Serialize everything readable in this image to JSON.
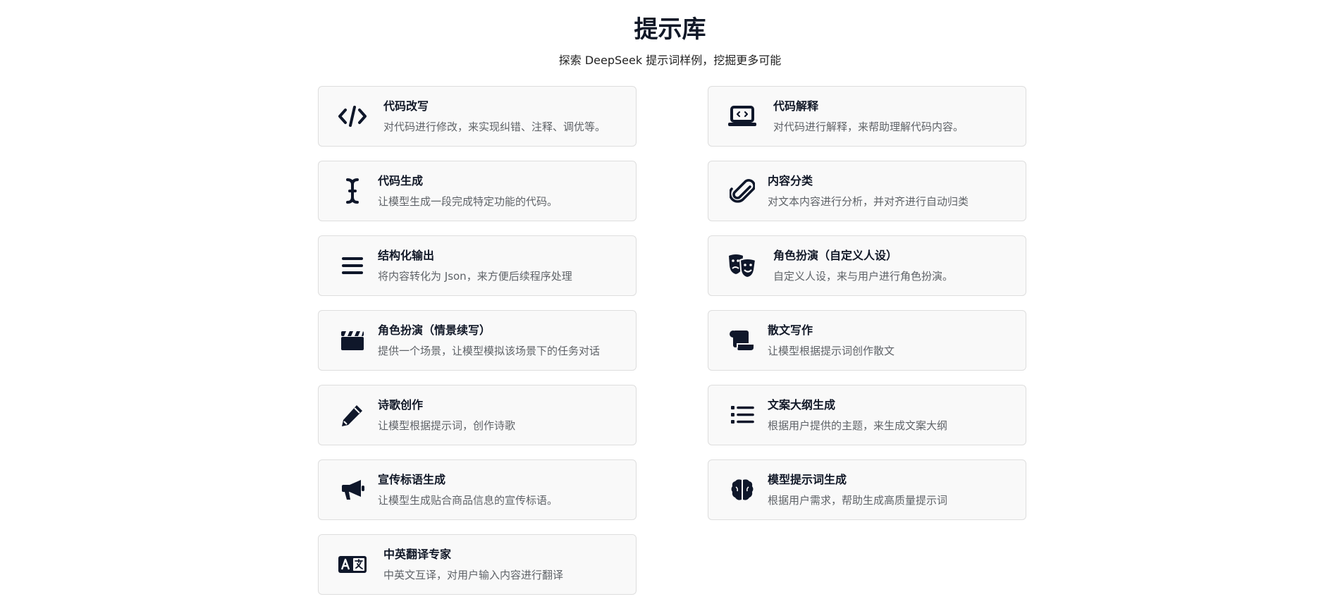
{
  "header": {
    "title": "提示库",
    "subtitle": "探索 DeepSeek 提示词样例，挖掘更多可能"
  },
  "cards": [
    {
      "title": "代码改写",
      "desc": "对代码进行修改，来实现纠错、注释、调优等。",
      "icon": "code-icon"
    },
    {
      "title": "代码解释",
      "desc": "对代码进行解释，来帮助理解代码内容。",
      "icon": "laptop-code-icon"
    },
    {
      "title": "代码生成",
      "desc": "让模型生成一段完成特定功能的代码。",
      "icon": "text-cursor-icon"
    },
    {
      "title": "内容分类",
      "desc": "对文本内容进行分析，并对齐进行自动归类",
      "icon": "paperclip-icon"
    },
    {
      "title": "结构化输出",
      "desc": "将内容转化为 Json，来方便后续程序处理",
      "icon": "menu-lines-icon"
    },
    {
      "title": "角色扮演（自定义人设）",
      "desc": "自定义人设，来与用户进行角色扮演。",
      "icon": "theater-masks-icon"
    },
    {
      "title": "角色扮演（情景续写）",
      "desc": "提供一个场景，让模型模拟该场景下的任务对话",
      "icon": "clapperboard-icon"
    },
    {
      "title": "散文写作",
      "desc": "让模型根据提示词创作散文",
      "icon": "scroll-icon"
    },
    {
      "title": "诗歌创作",
      "desc": "让模型根据提示词，创作诗歌",
      "icon": "pencil-icon"
    },
    {
      "title": "文案大纲生成",
      "desc": "根据用户提供的主题，来生成文案大纲",
      "icon": "list-icon"
    },
    {
      "title": "宣传标语生成",
      "desc": "让模型生成贴合商品信息的宣传标语。",
      "icon": "megaphone-icon"
    },
    {
      "title": "模型提示词生成",
      "desc": "根据用户需求，帮助生成高质量提示词",
      "icon": "brain-icon"
    },
    {
      "title": "中英翻译专家",
      "desc": "中英文互译，对用户输入内容进行翻译",
      "icon": "language-icon"
    }
  ]
}
